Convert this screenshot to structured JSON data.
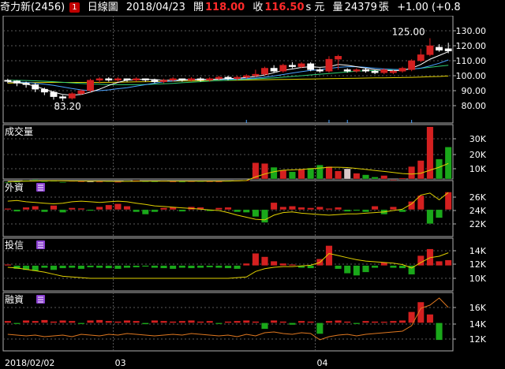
{
  "header": {
    "stock_name": "奇力新(2456)",
    "badge": "1",
    "chart_type": "日線圖",
    "date": "2018/04/23",
    "open_label": "開",
    "open_value": "118.00",
    "close_label": "收",
    "close_value": "116.50",
    "unit": "s 元",
    "volume_label": "量",
    "volume_value": "24379",
    "volume_unit": "張",
    "change": "+1.00 (+0.8"
  },
  "colors": {
    "up": "#d42020",
    "down": "#1aa81a",
    "ma5": "#ffffff",
    "ma10": "#4aa3ff",
    "ma20": "#2ecc71",
    "ma60": "#e0d000",
    "grid": "#5a5a5a",
    "border": "#b0b0b0"
  },
  "chart_data": [
    {
      "panel": "price",
      "type": "candlestick",
      "y_ticks": [
        "130.00",
        "120.00",
        "110.00",
        "100.00",
        "90.00",
        "80.00"
      ],
      "ylim": [
        72,
        138
      ],
      "annotations": [
        {
          "text": "125.00",
          "x_index": 44
        },
        {
          "text": "83.20",
          "x_index": 6
        }
      ],
      "candles": [
        {
          "o": 97,
          "c": 96.5,
          "h": 98,
          "l": 95
        },
        {
          "o": 96.5,
          "c": 95,
          "h": 97,
          "l": 93
        },
        {
          "o": 95,
          "c": 94,
          "h": 96,
          "l": 92
        },
        {
          "o": 94,
          "c": 91,
          "h": 95,
          "l": 89
        },
        {
          "o": 91,
          "c": 89,
          "h": 92,
          "l": 87
        },
        {
          "o": 89,
          "c": 86,
          "h": 90,
          "l": 84
        },
        {
          "o": 86,
          "c": 85,
          "h": 87,
          "l": 83.2
        },
        {
          "o": 85,
          "c": 88,
          "h": 89,
          "l": 84
        },
        {
          "o": 88,
          "c": 90,
          "h": 91,
          "l": 87
        },
        {
          "o": 90,
          "c": 97,
          "h": 98,
          "l": 89
        },
        {
          "o": 97,
          "c": 98,
          "h": 99,
          "l": 95
        },
        {
          "o": 98,
          "c": 97,
          "h": 99,
          "l": 96
        },
        {
          "o": 97,
          "c": 98,
          "h": 99,
          "l": 96
        },
        {
          "o": 98,
          "c": 97,
          "h": 98,
          "l": 96
        },
        {
          "o": 97,
          "c": 98,
          "h": 99,
          "l": 96
        },
        {
          "o": 98,
          "c": 97,
          "h": 98,
          "l": 96
        },
        {
          "o": 97,
          "c": 96,
          "h": 98,
          "l": 95
        },
        {
          "o": 96,
          "c": 97,
          "h": 98,
          "l": 95
        },
        {
          "o": 97,
          "c": 98,
          "h": 99,
          "l": 96
        },
        {
          "o": 98,
          "c": 97,
          "h": 98,
          "l": 96
        },
        {
          "o": 97,
          "c": 98,
          "h": 99,
          "l": 96
        },
        {
          "o": 98,
          "c": 97,
          "h": 99,
          "l": 96
        },
        {
          "o": 97,
          "c": 98,
          "h": 99,
          "l": 96
        },
        {
          "o": 98,
          "c": 99,
          "h": 100,
          "l": 97
        },
        {
          "o": 99,
          "c": 98,
          "h": 100,
          "l": 97
        },
        {
          "o": 98,
          "c": 99,
          "h": 100,
          "l": 97
        },
        {
          "o": 99,
          "c": 100,
          "h": 101,
          "l": 98
        },
        {
          "o": 100,
          "c": 101,
          "h": 104,
          "l": 99
        },
        {
          "o": 101,
          "c": 105,
          "h": 106,
          "l": 100
        },
        {
          "o": 105,
          "c": 103,
          "h": 107,
          "l": 102
        },
        {
          "o": 103,
          "c": 107,
          "h": 108,
          "l": 102
        },
        {
          "o": 107,
          "c": 106,
          "h": 109,
          "l": 105
        },
        {
          "o": 106,
          "c": 108,
          "h": 109,
          "l": 105
        },
        {
          "o": 108,
          "c": 104,
          "h": 109,
          "l": 103
        },
        {
          "o": 104,
          "c": 103,
          "h": 105,
          "l": 102
        },
        {
          "o": 103,
          "c": 111,
          "h": 113,
          "l": 102
        },
        {
          "o": 111,
          "c": 113,
          "h": 114,
          "l": 104
        },
        {
          "o": 104,
          "c": 103,
          "h": 105,
          "l": 102
        },
        {
          "o": 103,
          "c": 104,
          "h": 105,
          "l": 102
        },
        {
          "o": 104,
          "c": 103,
          "h": 105,
          "l": 102
        },
        {
          "o": 103,
          "c": 102,
          "h": 104,
          "l": 101
        },
        {
          "o": 102,
          "c": 104,
          "h": 105,
          "l": 101
        },
        {
          "o": 102,
          "c": 103,
          "h": 104,
          "l": 101
        },
        {
          "o": 103,
          "c": 105,
          "h": 106,
          "l": 102
        },
        {
          "o": 104,
          "c": 110,
          "h": 111,
          "l": 103
        },
        {
          "o": 110,
          "c": 114,
          "h": 118,
          "l": 109
        },
        {
          "o": 114,
          "c": 120,
          "h": 125,
          "l": 113
        },
        {
          "o": 119,
          "c": 117,
          "h": 121,
          "l": 116
        },
        {
          "o": 118,
          "c": 116.5,
          "h": 122,
          "l": 115
        }
      ],
      "ma": {
        "ma5": [
          96,
          95.5,
          94.5,
          93,
          91,
          89,
          87.5,
          87,
          87.5,
          89,
          91,
          93.5,
          95.5,
          97,
          97.5,
          97.5,
          97.5,
          97,
          97,
          97.2,
          97.5,
          97.5,
          97.6,
          97.8,
          98,
          98.3,
          98.8,
          99.5,
          100.5,
          102,
          103.5,
          104.5,
          105.5,
          106,
          105.6,
          106,
          107.5,
          107,
          106,
          105,
          104,
          103.5,
          103.3,
          103.5,
          105,
          107.5,
          111,
          113.5,
          116
        ],
        "ma10": [
          96,
          95.8,
          95.5,
          95,
          94.3,
          93.5,
          92.5,
          91.5,
          90.5,
          90,
          90,
          90.5,
          91.3,
          92,
          93,
          94,
          95,
          96,
          96.5,
          97,
          97.2,
          97.3,
          97.4,
          97.5,
          97.6,
          97.8,
          98,
          98.4,
          99,
          99.8,
          100.8,
          101.8,
          102.7,
          103.5,
          104,
          104.8,
          105.6,
          106,
          106,
          105.6,
          105,
          104.5,
          104.2,
          104,
          104.3,
          105,
          106.5,
          108.3,
          110.5
        ],
        "ma20": [
          97,
          96.9,
          96.8,
          96.6,
          96.3,
          96,
          95.6,
          95.2,
          94.8,
          94.5,
          94.3,
          94.1,
          94,
          94,
          94,
          94.1,
          94.3,
          94.6,
          94.9,
          95.3,
          95.7,
          96,
          96.4,
          96.7,
          97,
          97.3,
          97.6,
          97.9,
          98.2,
          98.6,
          99,
          99.5,
          100,
          100.5,
          101,
          101.5,
          102,
          102.5,
          103,
          103.3,
          103.6,
          103.8,
          104,
          104.2,
          104.5,
          105,
          105.6,
          106.3,
          107
        ],
        "ma60": [
          95,
          95.2,
          95.3,
          95.4,
          95.5,
          95.5,
          95.5,
          95.5,
          95.5,
          95.5,
          95.5,
          95.6,
          95.7,
          95.8,
          95.9,
          96,
          96.1,
          96.2,
          96.3,
          96.4,
          96.5,
          96.6,
          96.7,
          96.8,
          96.9,
          97,
          97.1,
          97.2,
          97.3,
          97.4,
          97.5,
          97.6,
          97.7,
          97.8,
          97.9,
          98,
          98.1,
          98.2,
          98.3,
          98.4,
          98.5,
          98.6,
          98.7,
          98.8,
          98.9,
          99.1,
          99.3,
          99.5,
          99.8
        ]
      }
    },
    {
      "panel": "volume",
      "type": "bar",
      "title": "成交量",
      "y_ticks": [
        "30K",
        "20K",
        "10K"
      ],
      "ylim": [
        0,
        38000
      ],
      "values": [
        900,
        1500,
        2200,
        2800,
        1800,
        2000,
        1200,
        1900,
        1600,
        1500,
        1400,
        1800,
        1300,
        2000,
        2200,
        1700,
        1600,
        1900,
        1500,
        1400,
        1700,
        1800,
        1600,
        1500,
        1900,
        2100,
        2300,
        14000,
        13500,
        11000,
        9000,
        8000,
        9500,
        10500,
        12500,
        11500,
        8500,
        10000,
        7000,
        6000,
        4500,
        5500,
        2800,
        3800,
        11500,
        15500,
        38000,
        16500,
        24500
      ],
      "ma": [
        1500,
        1600,
        1700,
        1800,
        1900,
        1950,
        1900,
        1850,
        1800,
        1750,
        1700,
        1650,
        1600,
        1600,
        1650,
        1700,
        1750,
        1750,
        1700,
        1700,
        1700,
        1700,
        1700,
        1750,
        1800,
        1900,
        2100,
        4500,
        6500,
        8000,
        9000,
        9200,
        9500,
        10000,
        10500,
        11000,
        11000,
        10800,
        10200,
        9500,
        8800,
        8200,
        7500,
        6800,
        6500,
        7000,
        9000,
        11000,
        13500
      ]
    },
    {
      "panel": "foreign",
      "type": "bar",
      "title": "外資",
      "y_ticks": [
        "26K",
        "24K",
        "22K"
      ],
      "ylim": [
        20800,
        27600
      ],
      "values": [
        0.05,
        -0.08,
        0.1,
        0.15,
        -0.1,
        0.18,
        -0.12,
        0.08,
        0.06,
        -0.05,
        0.12,
        0.2,
        0.25,
        0.15,
        -0.1,
        -0.2,
        -0.1,
        0.08,
        0.1,
        -0.08,
        0.12,
        0.1,
        -0.06,
        0.08,
        0.1,
        -0.1,
        -0.12,
        -0.3,
        -0.55,
        0.3,
        0.12,
        0.15,
        0.1,
        0.08,
        0.12,
        0.05,
        0.1,
        -0.08,
        -0.05,
        -0.1,
        0.15,
        -0.2,
        0.12,
        -0.1,
        0.35,
        0.6,
        -0.6,
        -0.35,
        0.75
      ],
      "holdings": [
        25400,
        25500,
        25300,
        25200,
        25100,
        25000,
        25100,
        25300,
        25400,
        25300,
        25200,
        25300,
        25400,
        25300,
        25100,
        24900,
        24700,
        24600,
        24500,
        24400,
        24300,
        24200,
        24100,
        24000,
        23700,
        23300,
        23000,
        22700,
        22600,
        23300,
        23700,
        23800,
        23600,
        23500,
        23400,
        23300,
        23400,
        23500,
        23500,
        23600,
        23700,
        23800,
        24000,
        24200,
        25000,
        26300,
        26600,
        25600,
        26700
      ]
    },
    {
      "panel": "investment_trust",
      "type": "bar",
      "title": "投信",
      "y_ticks": [
        "14K",
        "12K",
        "10K"
      ],
      "ylim": [
        8400,
        15600
      ],
      "values": [
        0.05,
        -0.15,
        -0.2,
        -0.25,
        -0.1,
        -0.2,
        -0.12,
        -0.1,
        -0.15,
        -0.08,
        -0.1,
        -0.12,
        -0.15,
        -0.1,
        -0.08,
        -0.05,
        -0.1,
        -0.12,
        -0.15,
        -0.1,
        -0.12,
        -0.1,
        -0.08,
        -0.1,
        -0.12,
        -0.15,
        0.1,
        0.55,
        0.4,
        0.2,
        0.1,
        0.05,
        -0.1,
        -0.12,
        0.3,
        0.9,
        -0.15,
        -0.35,
        -0.45,
        -0.3,
        -0.1,
        0.15,
        -0.1,
        -0.12,
        -0.4,
        0.45,
        0.75,
        0.2,
        0.25
      ],
      "holdings": [
        11600,
        11500,
        11300,
        11100,
        10900,
        10600,
        10300,
        10200,
        10100,
        10000,
        10000,
        10000,
        10000,
        10000,
        10000,
        10000,
        10000,
        10000,
        10000,
        10000,
        10000,
        10000,
        10000,
        10000,
        10000,
        10100,
        10200,
        11000,
        11400,
        11600,
        11700,
        11700,
        11800,
        11900,
        12300,
        13600,
        13300,
        13000,
        12700,
        12500,
        12400,
        12300,
        12200,
        12000,
        11500,
        12300,
        13000,
        13200,
        13700
      ]
    },
    {
      "panel": "margin",
      "type": "bar",
      "title": "融資",
      "y_ticks": [
        "16K",
        "14K",
        "12K"
      ],
      "ylim": [
        10800,
        18000
      ],
      "values": [
        0.08,
        -0.05,
        0.1,
        0.08,
        0.12,
        0.06,
        0.1,
        0.08,
        -0.05,
        0.1,
        0.12,
        0.08,
        0.06,
        0.1,
        0.08,
        -0.06,
        0.1,
        0.08,
        0.06,
        0.08,
        0.1,
        0.06,
        0.08,
        -0.05,
        0.06,
        0.08,
        0.1,
        0.06,
        -0.25,
        0.1,
        0.06,
        -0.08,
        0.08,
        0.06,
        -0.45,
        0.08,
        0.1,
        0.06,
        -0.05,
        0.08,
        0.06,
        0.05,
        0.08,
        0.1,
        0.45,
        0.85,
        0.35,
        -0.7
      ],
      "holdings": [
        12600,
        12500,
        12400,
        12500,
        12300,
        12400,
        12500,
        12300,
        12600,
        12500,
        12400,
        12600,
        12500,
        12700,
        12600,
        12500,
        12400,
        12500,
        12600,
        12500,
        12700,
        12600,
        12500,
        12400,
        12500,
        12300,
        12600,
        12400,
        12800,
        12900,
        12700,
        12600,
        12800,
        12700,
        11900,
        12300,
        12500,
        12600,
        12400,
        12600,
        12700,
        12800,
        12900,
        13000,
        13700,
        15900,
        16300,
        17200,
        16000
      ]
    }
  ],
  "x_axis": {
    "labels": [
      {
        "text": "2018/02/02",
        "x_index": 0
      },
      {
        "text": "03",
        "x_index": 12
      },
      {
        "text": "04",
        "x_index": 34
      }
    ]
  }
}
